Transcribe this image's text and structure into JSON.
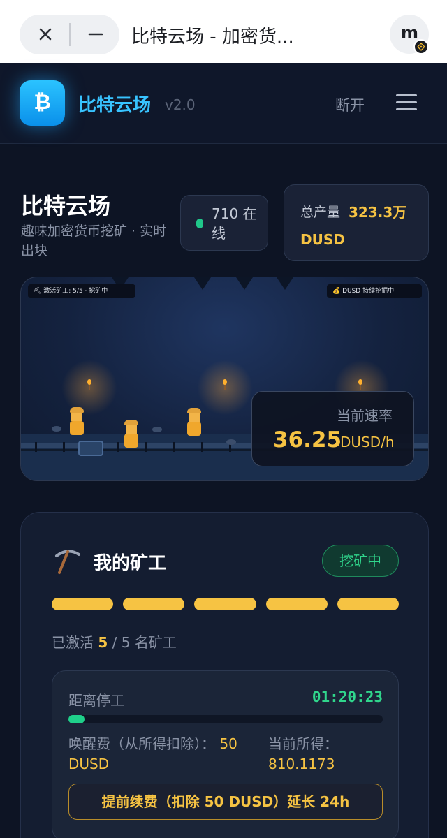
{
  "browser": {
    "tab_title": "比特云场 - 加密货...",
    "avatar_letter": "m"
  },
  "header": {
    "logo_symbol": "₿",
    "brand_name": "比特云场",
    "version": "v2.0",
    "disconnect_label": "断开"
  },
  "hero": {
    "title": "比特云场",
    "subtitle": "趣味加密货币挖矿 · 实时出块",
    "online_text": "710 在线",
    "total_label": "总产量",
    "total_value": "323.3万",
    "total_unit": "DUSD"
  },
  "scene": {
    "left_tag": "⛏ 激活矿工: 5/5 · 挖矿中",
    "right_tag": "💰 DUSD 持续挖掘中",
    "rate_label": "当前速率",
    "rate_value": "36.25",
    "rate_unit": "DUSD/h"
  },
  "miners": {
    "title": "我的矿工",
    "status": "挖矿中",
    "slots_active": 5,
    "slots_total": 5,
    "active_prefix": "已激活",
    "active_count": "5",
    "active_suffix": "/ 5 名矿工",
    "timer_label": "距离停工",
    "timer_value": "01:20:23",
    "timer_progress": 0.05,
    "wake_fee_label": "唤醒费（从所得扣除）：",
    "wake_fee_value": "50 DUSD",
    "earned_label": "当前所得：",
    "earned_value": "810.1173",
    "renew_button": "提前续费（扣除 50 DUSD）延长 24h"
  },
  "colors": {
    "accent_gold": "#f6c343",
    "accent_green": "#30d68c",
    "brand_blue": "#38c3ff",
    "background": "#0d1424"
  },
  "icons": [
    "close-icon",
    "minimize-icon",
    "wallet-badge-icon",
    "bitcoin-logo-icon",
    "hamburger-menu-icon",
    "pickaxe-icon",
    "online-dot-icon"
  ]
}
